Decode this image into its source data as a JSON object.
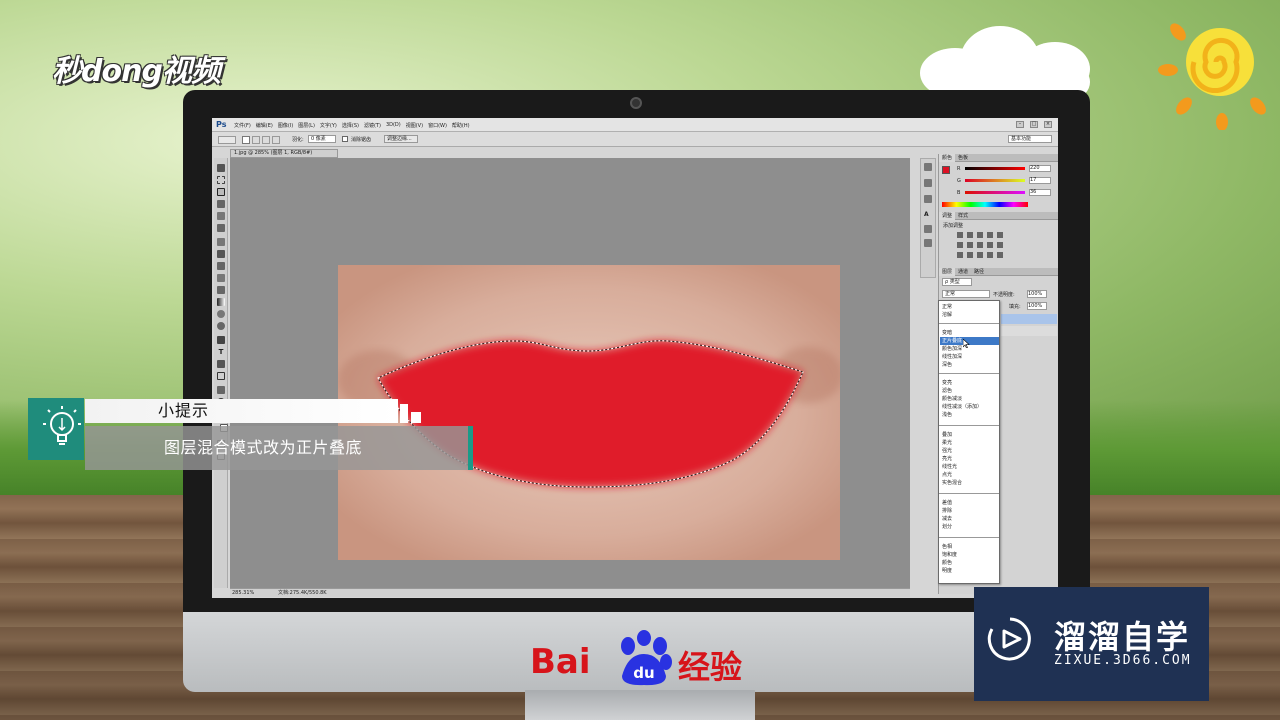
{
  "brand_logo": "秒dong视频",
  "photoshop": {
    "app_logo": "Ps",
    "menu": [
      "文件(F)",
      "编辑(E)",
      "图像(I)",
      "图层(L)",
      "文字(Y)",
      "选择(S)",
      "滤镜(T)",
      "3D(D)",
      "视图(V)",
      "窗口(W)",
      "帮助(H)"
    ],
    "window_controls": [
      "–",
      "□",
      "×"
    ],
    "options": {
      "feather_label": "羽化:",
      "feather_value": "0 像素",
      "antialias_label": "消除锯齿",
      "refine_edge": "调整边缘...",
      "workspace": "基本功能"
    },
    "document_tab": "1.jpg @ 285% (图层 1, RGB/8#)",
    "status": {
      "zoom": "285.31%",
      "doc_size": "文档:275.4K/550.8K"
    },
    "panels": {
      "color_tabs": [
        "颜色",
        "色板"
      ],
      "color_values": {
        "r_label": "R",
        "r": "220",
        "g_label": "G",
        "g": "17",
        "b_label": "B",
        "b": "36"
      },
      "adjust_tabs": [
        "调整",
        "样式"
      ],
      "adjust_title": "添加调整",
      "layers_tabs": [
        "图层",
        "通道",
        "路径"
      ],
      "kind_filter": "ρ 类型",
      "blend_mode_current": "正常",
      "opacity_label": "不透明度:",
      "opacity_value": "100%",
      "fill_label": "填充:",
      "fill_value": "100%"
    },
    "blend_modes": [
      [
        "正常",
        "溶解"
      ],
      [
        "变暗",
        "正片叠底",
        "颜色加深",
        "线性加深",
        "深色"
      ],
      [
        "变亮",
        "滤色",
        "颜色减淡",
        "线性减淡（添加）",
        "浅色"
      ],
      [
        "叠加",
        "柔光",
        "强光",
        "亮光",
        "线性光",
        "点光",
        "实色混合"
      ],
      [
        "差值",
        "排除",
        "减去",
        "划分"
      ],
      [
        "色相",
        "饱和度",
        "颜色",
        "明度"
      ]
    ],
    "blend_mode_selected": "正片叠底"
  },
  "tip": {
    "title": "小提示",
    "body": "图层混合模式改为正片叠底"
  },
  "baidu": {
    "brand": "Bai",
    "paw_text": "du",
    "suffix": "经验"
  },
  "watermark": {
    "title": "溜溜自学",
    "subtitle": "ZIXUE.3D66.COM"
  },
  "colors": {
    "lip_red": "#e01b2a",
    "tip_teal": "#1f8c7c",
    "watermark_bg": "#1f3153",
    "baidu_red": "#d7141a",
    "baidu_blue": "#2932e1"
  }
}
